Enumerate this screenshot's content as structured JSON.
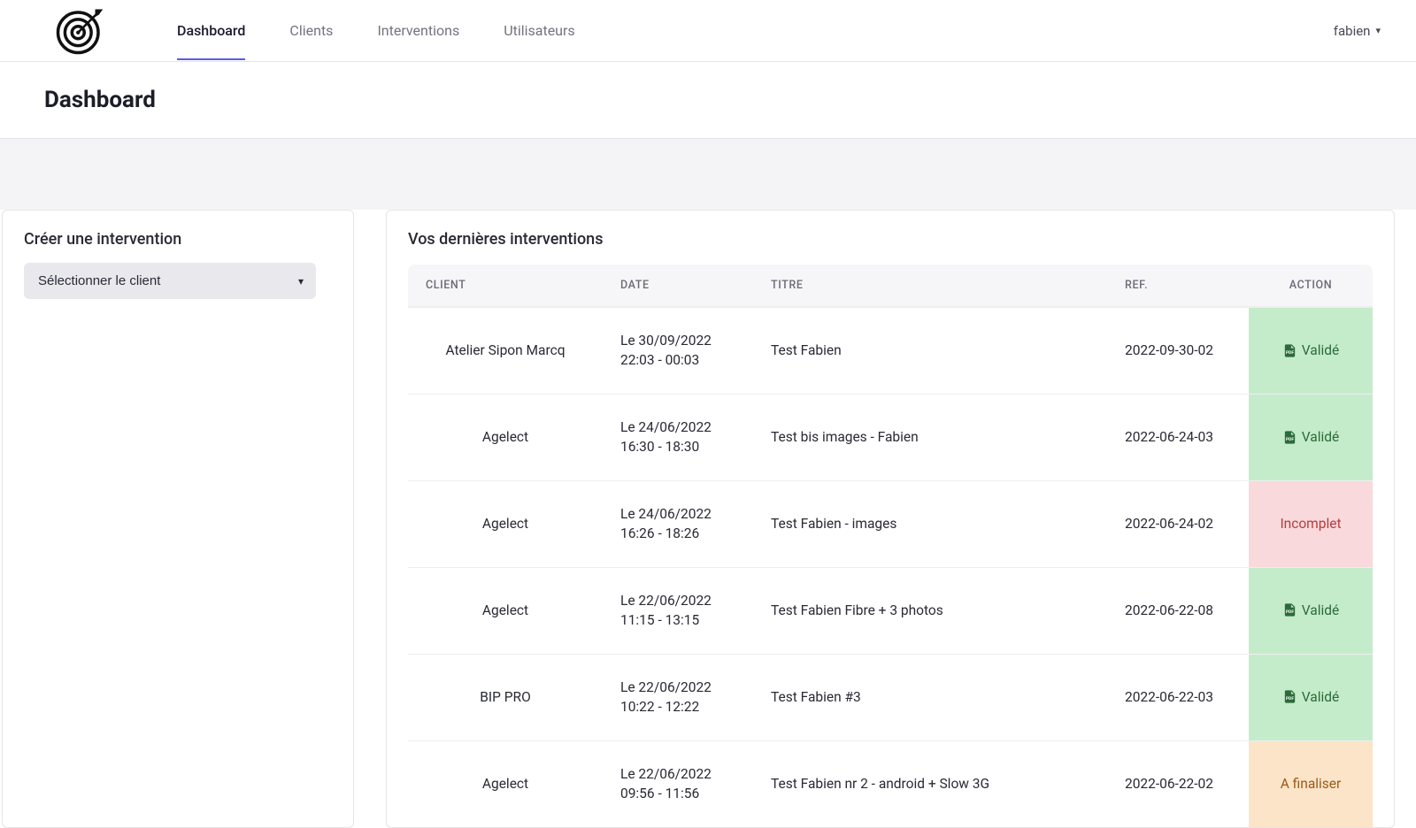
{
  "nav": {
    "items": [
      {
        "label": "Dashboard",
        "active": true
      },
      {
        "label": "Clients",
        "active": false
      },
      {
        "label": "Interventions",
        "active": false
      },
      {
        "label": "Utilisateurs",
        "active": false
      }
    ]
  },
  "user": {
    "name": "fabien"
  },
  "page": {
    "title": "Dashboard"
  },
  "create": {
    "heading": "Créer une intervention",
    "select_placeholder": "Sélectionner le client"
  },
  "recent": {
    "heading": "Vos dernières interventions",
    "columns": {
      "client": "CLIENT",
      "date": "DATE",
      "titre": "TITRE",
      "ref": "REF.",
      "action": "ACTION"
    },
    "rows": [
      {
        "client": "Atelier Sipon Marcq",
        "date_l1": "Le 30/09/2022",
        "date_l2": "22:03 - 00:03",
        "titre": "Test Fabien",
        "ref": "2022-09-30-02",
        "status": "Validé",
        "status_type": "valide"
      },
      {
        "client": "Agelect",
        "date_l1": "Le 24/06/2022",
        "date_l2": "16:30 - 18:30",
        "titre": "Test bis images - Fabien",
        "ref": "2022-06-24-03",
        "status": "Validé",
        "status_type": "valide"
      },
      {
        "client": "Agelect",
        "date_l1": "Le 24/06/2022",
        "date_l2": "16:26 - 18:26",
        "titre": "Test Fabien - images",
        "ref": "2022-06-24-02",
        "status": "Incomplet",
        "status_type": "incomplet"
      },
      {
        "client": "Agelect",
        "date_l1": "Le 22/06/2022",
        "date_l2": "11:15 - 13:15",
        "titre": "Test Fabien Fibre + 3 photos",
        "ref": "2022-06-22-08",
        "status": "Validé",
        "status_type": "valide"
      },
      {
        "client": "BIP PRO",
        "date_l1": "Le 22/06/2022",
        "date_l2": "10:22 - 12:22",
        "titre": "Test Fabien #3",
        "ref": "2022-06-22-03",
        "status": "Validé",
        "status_type": "valide"
      },
      {
        "client": "Agelect",
        "date_l1": "Le 22/06/2022",
        "date_l2": "09:56 - 11:56",
        "titre": "Test Fabien nr 2 - android + Slow 3G",
        "ref": "2022-06-22-02",
        "status": "A finaliser",
        "status_type": "afinaliser"
      }
    ]
  }
}
